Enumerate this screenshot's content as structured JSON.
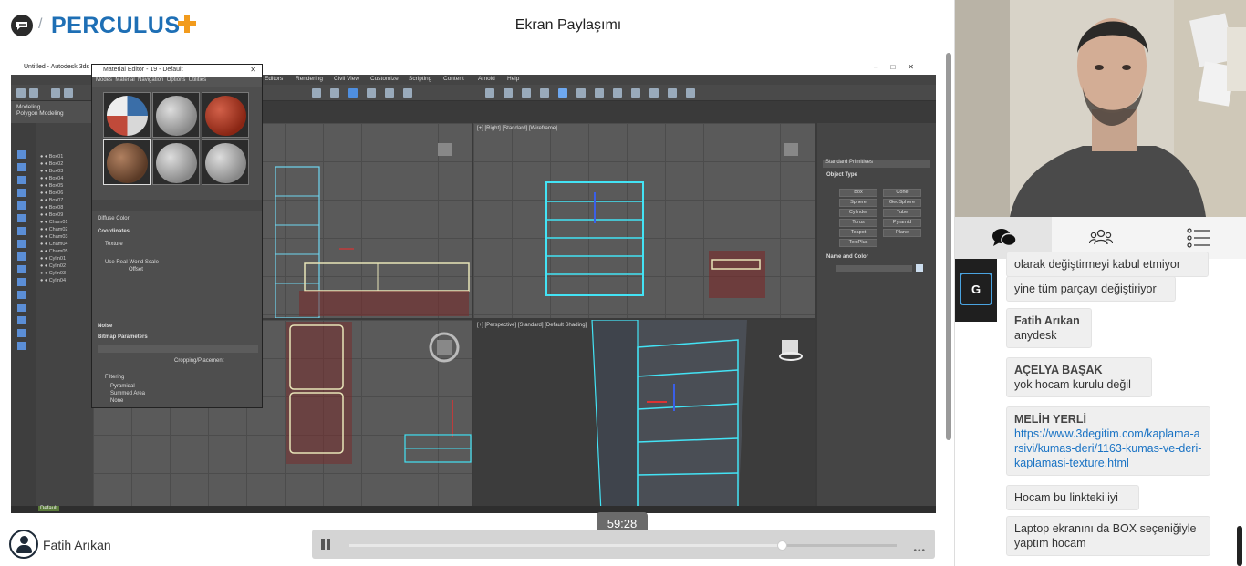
{
  "header": {
    "logo_text": "PERCULUS",
    "page_title": "Ekran Paylaşımı"
  },
  "shared_screen": {
    "app_title": "Untitled - Autodesk 3ds Max",
    "menu": [
      "Editors",
      "Rendering",
      "Civil View",
      "Customize",
      "Scripting",
      "Content",
      "Arnold",
      "Help"
    ],
    "ribbon": [
      "Modeling",
      "Polygon Modeling"
    ],
    "material_editor": {
      "title": "Material Editor - 19 - Default",
      "menu": [
        "Modes",
        "Material",
        "Navigation",
        "Options",
        "Utilities"
      ],
      "rows": [
        "Diffuse Color",
        "Coordinates",
        "Texture",
        "Use Real-World Scale",
        "Offset",
        "Noise",
        "Bitmap Parameters",
        "Cropping/Placement",
        "Filtering",
        "Pyramidal",
        "Summed Area",
        "None"
      ]
    },
    "viewport_labels": {
      "top": "",
      "right": "[+] [Right] [Standard] [Wireframe]",
      "front": "",
      "perspective": "[+] [Perspective] [Standard] [Default Shading]"
    },
    "command_panel": {
      "dropdown": "Standard Primitives",
      "object_type": "Object Type",
      "buttons": [
        "Box",
        "Cone",
        "Sphere",
        "GeoSphere",
        "Cylinder",
        "Tube",
        "Torus",
        "Pyramid",
        "Teapot",
        "Plane",
        "TextPlus"
      ],
      "name_and_color": "Name and Color"
    },
    "status_text": "Default"
  },
  "player": {
    "presenter_name": "Fatih Arıkan",
    "time_label": "59:28",
    "progress": 0.79
  },
  "panel_tabs": [
    {
      "name": "chat",
      "icon": "chat-bubbles-icon",
      "active": true
    },
    {
      "name": "participants",
      "icon": "users-icon",
      "active": false
    },
    {
      "name": "list",
      "icon": "list-icon",
      "active": false
    }
  ],
  "chat": {
    "channel_initial": "G",
    "messages": [
      {
        "sender": "",
        "text": "olarak değiştirmeyi kabul etmiyor"
      },
      {
        "sender": "",
        "text": "yine tüm parçayı değiştiriyor"
      },
      {
        "sender": "Fatih Arıkan",
        "text": "anydesk"
      },
      {
        "sender": "AÇELYA BAŞAK",
        "text": "yok hocam kurulu değil"
      },
      {
        "sender": "MELİH YERLİ",
        "link": "https://www.3degitim.com/kaplama-arsivi/kumas-deri/1163-kumas-ve-deri-kaplamasi-texture.html"
      },
      {
        "sender": "",
        "text": "Hocam bu linkteki iyi"
      },
      {
        "sender": "",
        "text": "Laptop ekranını da BOX seçeniğiyle yaptım hocam"
      }
    ]
  }
}
